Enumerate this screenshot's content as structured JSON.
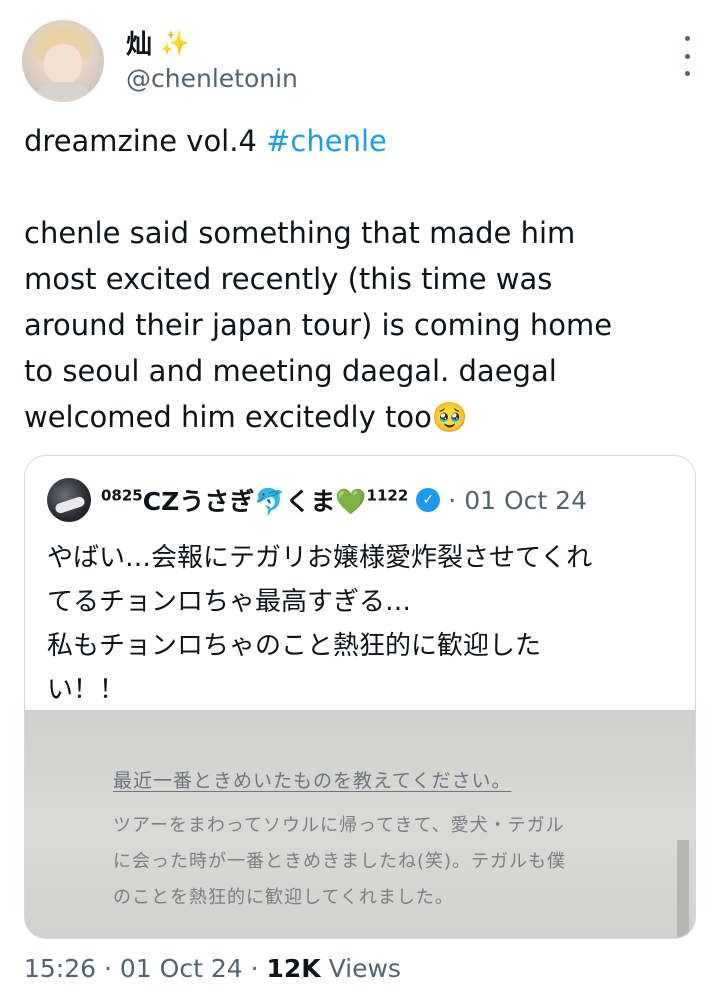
{
  "author": {
    "display_name": "灿",
    "sparkle_emoji": "✨",
    "handle": "@chenletonin"
  },
  "tweet": {
    "line1_text": "dreamzine vol.4 ",
    "hashtag": "#chenle",
    "body": "chenle said something that made him\nmost excited recently (this time was\naround their japan tour) is coming home\nto seoul and meeting daegal. daegal\nwelcomed him excitedly too",
    "trailing_emoji": "🥹"
  },
  "quote": {
    "name_prefix": "0825",
    "name_main": "CZうさぎ",
    "name_emoji1": "🐬",
    "name_mid": "くま",
    "name_emoji2": "💚",
    "name_suffix": "1122",
    "verified_mark": "✓",
    "separator": "·",
    "date": "01 Oct 24",
    "text": "やばい…会報にテガリお嬢様愛炸裂させてくれ\nてるチョンロちゃ最高すぎる…\n私もチョンロちゃのこと熱狂的に歓迎した\nい！！",
    "image": {
      "title": "最近一番ときめいたものを教えてください。",
      "body": "ツアーをまわってソウルに帰ってきて、愛犬・テガル\nに会った時が一番ときめきましたね(笑)。テガルも僕\nのことを熱狂的に歓迎してくれました。"
    }
  },
  "meta": {
    "time": "15:26",
    "sep1": " · ",
    "date": "01 Oct 24",
    "sep2": " · ",
    "views_count": "12K",
    "views_label": " Views"
  }
}
